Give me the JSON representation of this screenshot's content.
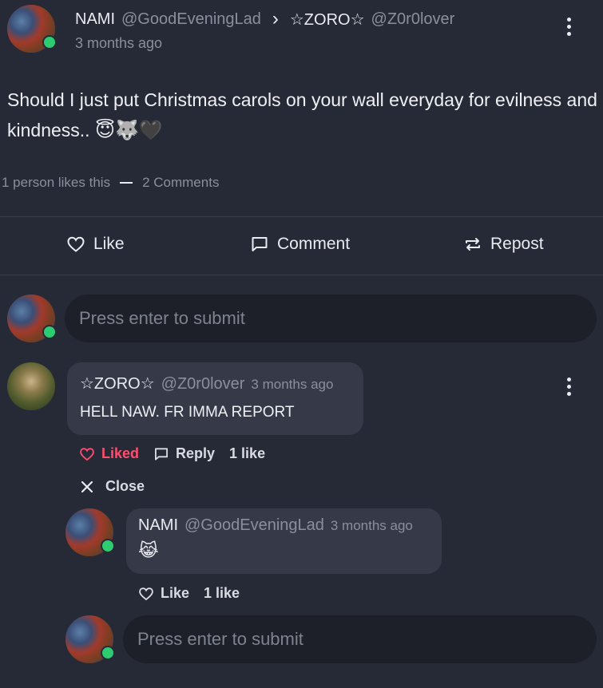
{
  "post": {
    "author_name": "NAMI",
    "author_handle": "@GoodEveningLad",
    "separator": "›",
    "target_name": "☆ZORO☆",
    "target_handle": "@Z0r0lover",
    "time": "3 months ago",
    "text": "Should I just put Christmas carols on your wall everyday for evilness and kindness..",
    "emojis": "😇🐺🖤",
    "likes_text": "1 person likes this",
    "comments_text": "2 Comments"
  },
  "actions": {
    "like": "Like",
    "comment": "Comment",
    "repost": "Repost"
  },
  "composer": {
    "placeholder": "Press enter to submit"
  },
  "comment": {
    "author_name": "☆ZORO☆",
    "author_handle": "@Z0r0lover",
    "time": "3 months ago",
    "text": "HELL NAW. FR IMMA REPORT",
    "liked_label": "Liked",
    "reply_label": "Reply",
    "like_count": "1 like",
    "close_label": "Close"
  },
  "reply": {
    "author_name": "NAMI",
    "author_handle": "@GoodEveningLad",
    "time": "3 months ago",
    "text": "😹",
    "like_label": "Like",
    "like_count": "1 like"
  },
  "reply_composer": {
    "placeholder": "Press enter to submit"
  },
  "colors": {
    "background": "#262a37",
    "liked": "#ff4d6d",
    "online": "#2ecc71"
  }
}
